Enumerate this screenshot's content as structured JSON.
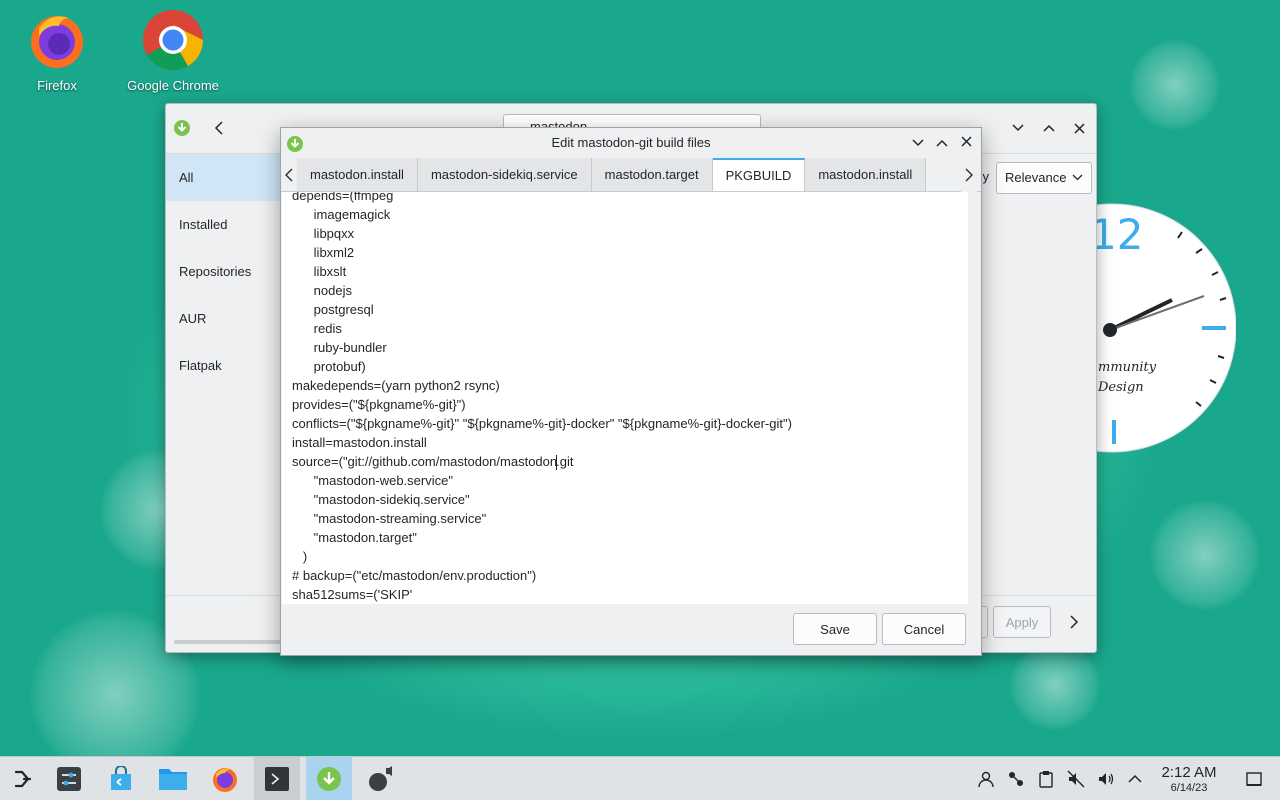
{
  "desktop": {
    "icons": [
      {
        "label": "Firefox",
        "icon": "firefox-icon"
      },
      {
        "label": "Google Chrome",
        "icon": "chrome-icon"
      }
    ]
  },
  "background_window": {
    "search_value": "mastodon",
    "sidebar": [
      "All",
      "Installed",
      "Repositories",
      "AUR",
      "Flatpak"
    ],
    "sort_label": ": by",
    "sort_value": "Relevance",
    "footer_buttons": {
      "apply": "Apply",
      "partial": "ce"
    }
  },
  "clock_widget": {
    "hour_numeral": "12",
    "text_line1": "mmunity",
    "text_line2": "Design"
  },
  "dialog": {
    "title": "Edit mastodon-git build files",
    "tabs": [
      {
        "label": "mastodon.install",
        "active": false
      },
      {
        "label": "mastodon-sidekiq.service",
        "active": false
      },
      {
        "label": "mastodon.target",
        "active": false
      },
      {
        "label": "PKGBUILD",
        "active": true
      },
      {
        "label": "mastodon.install",
        "active": false
      }
    ],
    "code_lines": [
      "depends=(ffmpeg",
      "      imagemagick",
      "      libpqxx",
      "      libxml2",
      "      libxslt",
      "      nodejs",
      "      postgresql",
      "      redis",
      "      ruby-bundler",
      "      protobuf)",
      "makedepends=(yarn python2 rsync)",
      "provides=(\"${pkgname%-git}\")",
      "conflicts=(\"${pkgname%-git}\" \"${pkgname%-git}-docker\" \"${pkgname%-git}-docker-git\")",
      "install=mastodon.install",
      "source=(\"git://github.com/mastodon/mastodon.git",
      "      \"mastodon-web.service\"",
      "      \"mastodon-sidekiq.service\"",
      "      \"mastodon-streaming.service\"",
      "      \"mastodon.target\"",
      "   )",
      "# backup=(\"etc/mastodon/env.production\")",
      "sha512sums=('SKIP'"
    ],
    "save_label": "Save",
    "cancel_label": "Cancel"
  },
  "taskbar": {
    "time": "2:12 AM",
    "date": "6/14/23"
  },
  "colors": {
    "accent": "#3daee9",
    "taskbar_active": "#a9d3ee"
  }
}
